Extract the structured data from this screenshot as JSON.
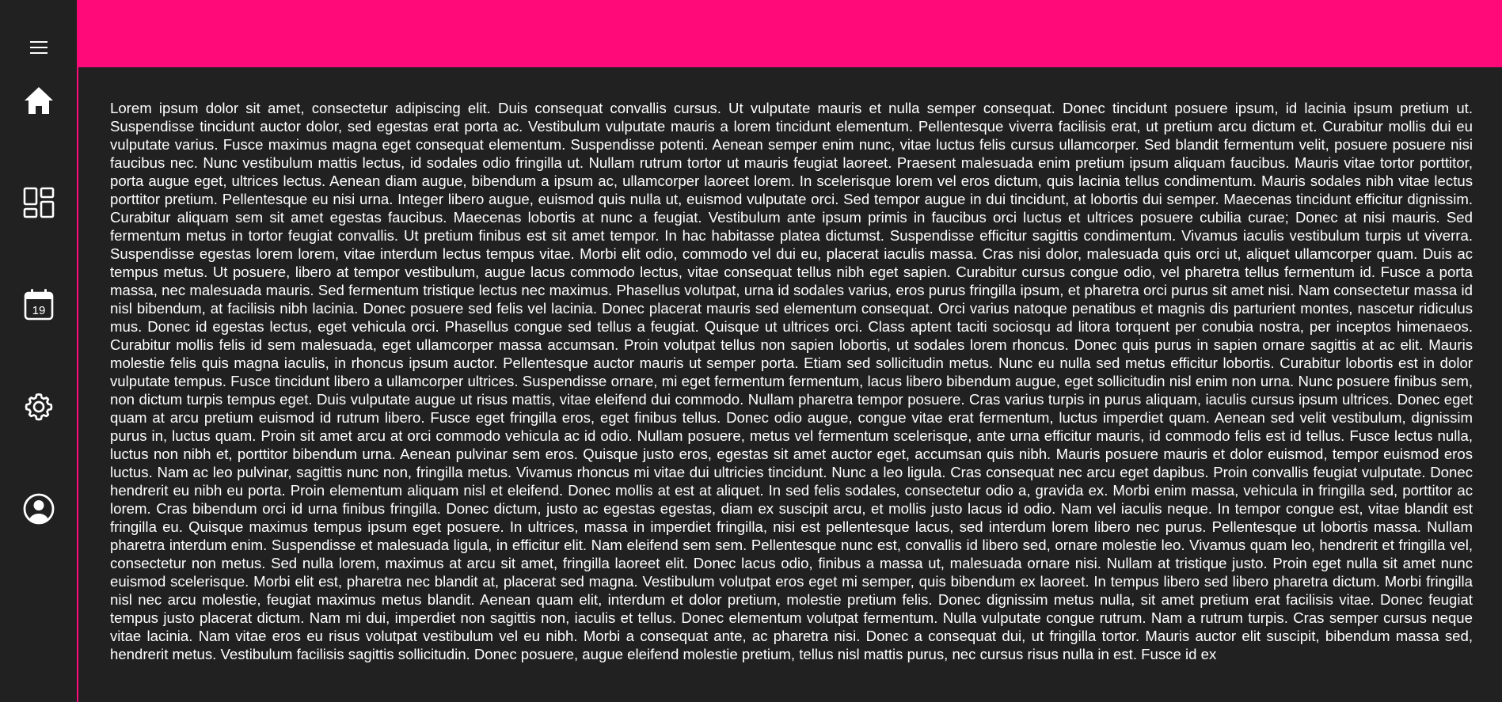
{
  "colors": {
    "accent": "#ff0a78",
    "background": "#212121",
    "text": "#ffffff"
  },
  "sidebar": {
    "items": [
      {
        "name": "menu",
        "icon": "hamburger-menu-icon"
      },
      {
        "name": "home",
        "icon": "home-icon"
      },
      {
        "name": "dashboard",
        "icon": "dashboard-icon"
      },
      {
        "name": "calendar",
        "icon": "calendar-icon",
        "badge": "19"
      },
      {
        "name": "settings",
        "icon": "gear-icon"
      },
      {
        "name": "account",
        "icon": "account-circle-icon"
      }
    ]
  },
  "main": {
    "body_text": "Lorem ipsum dolor sit amet, consectetur adipiscing elit. Duis consequat convallis cursus. Ut vulputate mauris et nulla semper consequat. Donec tincidunt posuere ipsum, id lacinia ipsum pretium ut. Suspendisse tincidunt auctor dolor, sed egestas erat porta ac. Vestibulum vulputate mauris a lorem tincidunt elementum. Pellentesque viverra facilisis erat, ut pretium arcu dictum et. Curabitur mollis dui eu vulputate varius. Fusce maximus magna eget consequat elementum. Suspendisse potenti. Aenean semper enim nunc, vitae luctus felis cursus ullamcorper. Sed blandit fermentum velit, posuere posuere nisi faucibus nec. Nunc vestibulum mattis lectus, id sodales odio fringilla ut. Nullam rutrum tortor ut mauris feugiat laoreet. Praesent malesuada enim pretium ipsum aliquam faucibus. Mauris vitae tortor porttitor, porta augue eget, ultrices lectus. Aenean diam augue, bibendum a ipsum ac, ullamcorper laoreet lorem. In scelerisque lorem vel eros dictum, quis lacinia tellus condimentum. Mauris sodales nibh vitae lectus porttitor pretium. Pellentesque eu nisi urna. Integer libero augue, euismod quis nulla ut, euismod vulputate orci. Sed tempor augue in dui tincidunt, at lobortis dui semper. Maecenas tincidunt efficitur dignissim. Curabitur aliquam sem sit amet egestas faucibus. Maecenas lobortis at nunc a feugiat. Vestibulum ante ipsum primis in faucibus orci luctus et ultrices posuere cubilia curae; Donec at nisi mauris. Sed fermentum metus in tortor feugiat convallis. Ut pretium finibus est sit amet tempor. In hac habitasse platea dictumst. Suspendisse efficitur sagittis condimentum. Vivamus iaculis vestibulum turpis ut viverra. Suspendisse egestas lorem lorem, vitae interdum lectus tempus vitae. Morbi elit odio, commodo vel dui eu, placerat iaculis massa. Cras nisi dolor, malesuada quis orci ut, aliquet ullamcorper quam. Duis ac tempus metus. Ut posuere, libero at tempor vestibulum, augue lacus commodo lectus, vitae consequat tellus nibh eget sapien. Curabitur cursus congue odio, vel pharetra tellus fermentum id. Fusce a porta massa, nec malesuada mauris. Sed fermentum tristique lectus nec maximus. Phasellus volutpat, urna id sodales varius, eros purus fringilla ipsum, et pharetra orci purus sit amet nisi. Nam consectetur massa id nisl bibendum, at facilisis nibh lacinia. Donec posuere sed felis vel lacinia. Donec placerat mauris sed elementum consequat. Orci varius natoque penatibus et magnis dis parturient montes, nascetur ridiculus mus. Donec id egestas lectus, eget vehicula orci. Phasellus congue sed tellus a feugiat. Quisque ut ultrices orci. Class aptent taciti sociosqu ad litora torquent per conubia nostra, per inceptos himenaeos. Curabitur mollis felis id sem malesuada, eget ullamcorper massa accumsan. Proin volutpat tellus non sapien lobortis, ut sodales lorem rhoncus. Donec quis purus in sapien ornare sagittis at ac elit. Mauris molestie felis quis magna iaculis, in rhoncus ipsum auctor. Pellentesque auctor mauris ut semper porta. Etiam sed sollicitudin metus. Nunc eu nulla sed metus efficitur lobortis. Curabitur lobortis est in dolor vulputate tempus. Fusce tincidunt libero a ullamcorper ultrices. Suspendisse ornare, mi eget fermentum fermentum, lacus libero bibendum augue, eget sollicitudin nisl enim non urna. Nunc posuere finibus sem, non dictum turpis tempus eget. Duis vulputate augue ut risus mattis, vitae eleifend dui commodo. Nullam pharetra tempor posuere. Cras varius turpis in purus aliquam, iaculis cursus ipsum ultrices. Donec eget quam at arcu pretium euismod id rutrum libero. Fusce eget fringilla eros, eget finibus tellus. Donec odio augue, congue vitae erat fermentum, luctus imperdiet quam. Aenean sed velit vestibulum, dignissim purus in, luctus quam. Proin sit amet arcu at orci commodo vehicula ac id odio. Nullam posuere, metus vel fermentum scelerisque, ante urna efficitur mauris, id commodo felis est id tellus. Fusce lectus nulla, luctus non nibh et, porttitor bibendum urna. Aenean pulvinar sem eros. Quisque justo eros, egestas sit amet auctor eget, accumsan quis nibh. Mauris posuere mauris et dolor euismod, tempor euismod eros luctus. Nam ac leo pulvinar, sagittis nunc non, fringilla metus. Vivamus rhoncus mi vitae dui ultricies tincidunt. Nunc a leo ligula. Cras consequat nec arcu eget dapibus. Proin convallis feugiat vulputate. Donec hendrerit eu nibh eu porta. Proin elementum aliquam nisl et eleifend. Donec mollis at est at aliquet. In sed felis sodales, consectetur odio a, gravida ex. Morbi enim massa, vehicula in fringilla sed, porttitor ac lorem. Cras bibendum orci id urna finibus fringilla. Donec dictum, justo ac egestas egestas, diam ex suscipit arcu, et mollis justo lacus id odio. Nam vel iaculis neque. In tempor congue est, vitae blandit est fringilla eu. Quisque maximus tempus ipsum eget posuere. In ultrices, massa in imperdiet fringilla, nisi est pellentesque lacus, sed interdum lorem libero nec purus. Pellentesque ut lobortis massa. Nullam pharetra interdum enim. Suspendisse et malesuada ligula, in efficitur elit. Nam eleifend sem sem. Pellentesque nunc est, convallis id libero sed, ornare molestie leo. Vivamus quam leo, hendrerit et fringilla vel, consectetur non metus. Sed nulla lorem, maximus at arcu sit amet, fringilla laoreet elit. Donec lacus odio, finibus a massa ut, malesuada ornare nisi. Nullam at tristique justo. Proin eget nulla sit amet nunc euismod scelerisque. Morbi elit est, pharetra nec blandit at, placerat sed magna. Vestibulum volutpat eros eget mi semper, quis bibendum ex laoreet. In tempus libero sed libero pharetra dictum. Morbi fringilla nisl nec arcu molestie, feugiat maximus metus blandit. Aenean quam elit, interdum et dolor pretium, molestie pretium felis. Donec dignissim metus nulla, sit amet pretium erat facilisis vitae. Donec feugiat tempus justo placerat dictum. Nam mi dui, imperdiet non sagittis non, iaculis et tellus. Donec elementum volutpat fermentum. Nulla vulputate congue rutrum. Nam a rutrum turpis. Cras semper cursus neque vitae lacinia. Nam vitae eros eu risus volutpat vestibulum vel eu nibh. Morbi a consequat ante, ac pharetra nisi. Donec a consequat dui, ut fringilla tortor. Mauris auctor elit suscipit, bibendum massa sed, hendrerit metus. Vestibulum facilisis sagittis sollicitudin. Donec posuere, augue eleifend molestie pretium, tellus nisl mattis purus, nec cursus risus nulla in est. Fusce id ex"
  }
}
